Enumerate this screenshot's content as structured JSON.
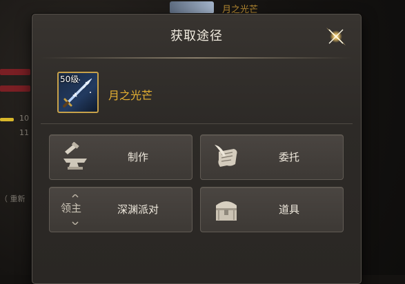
{
  "background": {
    "top_item_name": "月之光芒",
    "side_numbers": [
      "10",
      "11"
    ],
    "side_text": "（ 重新"
  },
  "dialog": {
    "title": "获取途径",
    "item": {
      "level": "50级",
      "name": "月之光芒",
      "icon": "sword-icon"
    },
    "sources": [
      {
        "label": "制作",
        "icon": "anvil-icon"
      },
      {
        "label": "委托",
        "icon": "scroll-quill-icon"
      },
      {
        "label": "深渊派对",
        "icon": "lord-icon",
        "icon_text": "领主"
      },
      {
        "label": "道具",
        "icon": "treasure-chest-icon"
      }
    ]
  },
  "colors": {
    "accent_gold": "#e8b232",
    "title_text": "#f1ebdf",
    "panel_bg": "#2d2a27"
  }
}
